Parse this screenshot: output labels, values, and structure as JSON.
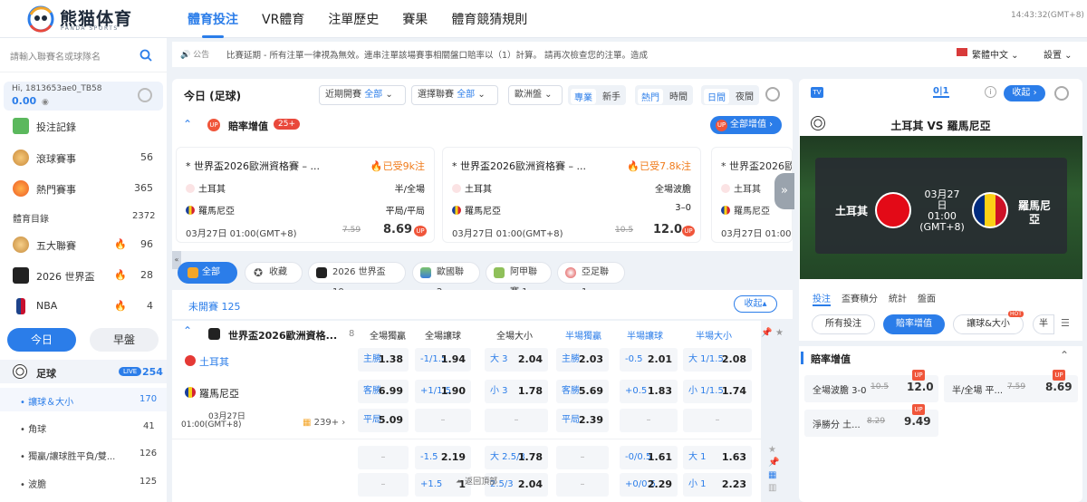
{
  "brand": {
    "name": "熊猫体育",
    "sub": "PANDA SPORTS"
  },
  "nav": [
    "體育投注",
    "VR體育",
    "注單歷史",
    "賽果",
    "體育競猜規則"
  ],
  "clock": "14:43:32(GMT+8)",
  "search": {
    "placeholder": "請輸入聯賽名或球隊名"
  },
  "notice": {
    "label": "公告",
    "text": "比賽延期 - 所有注單一律視為無效。連串注單該場賽事相關盤口賠率以（1）計算。 請再次檢查您的注單。造成",
    "lang": "繁體中文",
    "settings": "設置"
  },
  "account": {
    "id": "Hi, 1813653ae0_TB58",
    "balance": "0.00"
  },
  "sidebar": {
    "items": [
      {
        "label": "投注記錄",
        "count": ""
      },
      {
        "label": "滾球賽事",
        "count": "56"
      },
      {
        "label": "熱門賽事",
        "count": "365"
      }
    ],
    "catalog_label": "體育目錄",
    "catalog_count": "2372",
    "leagues": [
      {
        "label": "五大聯賽",
        "count": "96"
      },
      {
        "label": "2026 世界盃",
        "count": "28"
      },
      {
        "label": "NBA",
        "count": "4"
      }
    ],
    "today": "今日",
    "early": "早盤",
    "sport": {
      "label": "足球",
      "live": "LIVE",
      "count": "254"
    },
    "sub": [
      {
        "label": "讓球＆大小",
        "count": "170"
      },
      {
        "label": "角球",
        "count": "41"
      },
      {
        "label": "獨贏/讓球胜平負/雙...",
        "count": "126"
      },
      {
        "label": "波膽",
        "count": "125"
      }
    ]
  },
  "toolbar": {
    "title": "今日 (足球)",
    "f1": "近期開賽",
    "f1v": "全部",
    "f2": "選擇聯賽",
    "f2v": "全部",
    "f3": "歐洲盤",
    "t1": "專業",
    "t2": "新手",
    "t3": "熱門",
    "t4": "時間",
    "t5": "日間",
    "t6": "夜間"
  },
  "boost": {
    "title": "賠率增值",
    "count": "25+",
    "all": "全部增值"
  },
  "cards": [
    {
      "title": "* 世界盃2026歐洲資格賽 – ...",
      "hot": "已受9k注",
      "home": "土耳其",
      "away": "羅馬尼亞",
      "market": "半/全場",
      "pick": "平局/平局",
      "time": "03月27日 01:00(GMT+8)",
      "old": "7.59",
      "odd": "8.69"
    },
    {
      "title": "* 世界盃2026歐洲資格賽 – ...",
      "hot": "已受7.8k注",
      "home": "土耳其",
      "away": "羅馬尼亞",
      "market": "全場波膽",
      "pick": "3–0",
      "time": "03月27日 01:00(GMT+8)",
      "old": "10.5",
      "odd": "12.0"
    },
    {
      "title": "* 世界盃2026歐",
      "home": "土耳其",
      "away": "羅馬尼亞",
      "time": "03月27日 01:00(GMT+8)"
    }
  ],
  "chips": [
    "全部",
    "收藏",
    "2026 世界盃 10",
    "歐國聯 2",
    "阿甲聯賽 1",
    "亞足聯 1"
  ],
  "upcoming": {
    "label": "未開賽",
    "count": "125",
    "collapse": "收起"
  },
  "league": {
    "name": "世界盃2026歐洲資格...",
    "count": "8",
    "cols": [
      "全場獨贏",
      "全場讓球",
      "全場大小",
      "半場獨贏",
      "半場讓球",
      "半場大小"
    ]
  },
  "match": {
    "home": "土耳其",
    "away": "羅馬尼亞",
    "date": "03月27日",
    "time": "01:00(GMT+8)",
    "more": "239+",
    "row1": [
      [
        "主勝",
        "1.38"
      ],
      [
        "-1/1.5",
        "1.94"
      ],
      [
        "大 3",
        "2.04"
      ],
      [
        "主勝",
        "2.03"
      ],
      [
        "-0.5",
        "2.01"
      ],
      [
        "大 1/1.5",
        "2.08"
      ]
    ],
    "row2": [
      [
        "客勝",
        "6.99"
      ],
      [
        "+1/1.5",
        "1.90"
      ],
      [
        "小 3",
        "1.78"
      ],
      [
        "客勝",
        "5.69"
      ],
      [
        "+0.5",
        "1.83"
      ],
      [
        "小 1/1.5",
        "1.74"
      ]
    ],
    "row3": [
      [
        "平局",
        "5.09"
      ],
      [
        "",
        "–"
      ],
      [
        "",
        "–"
      ],
      [
        "平局",
        "2.39"
      ],
      [
        "",
        "–"
      ],
      [
        "",
        "–"
      ]
    ],
    "row4": [
      [
        "",
        "–"
      ],
      [
        "-1.5",
        "2.19"
      ],
      [
        "大 2.5/3",
        "1.78"
      ],
      [
        "",
        "–"
      ],
      [
        "-0/0.5",
        "1.61"
      ],
      [
        "大 1",
        "1.63"
      ]
    ],
    "row5": [
      [
        "",
        "–"
      ],
      [
        "+1.5",
        "1"
      ],
      [
        "2.5/3",
        "2.04"
      ],
      [
        "",
        "–"
      ],
      [
        "+0/0.5",
        "2.29"
      ],
      [
        "小 1",
        "2.23"
      ]
    ],
    "back_top": "返回頂部"
  },
  "rp": {
    "collapse": "收起",
    "match": "土耳其 VS 羅馬尼亞",
    "home": "土耳其",
    "away": "羅馬尼亞",
    "date": "03月27",
    "day": "日",
    "time": "01:00",
    "tz": "(GMT+8)",
    "tabs": [
      "投注",
      "盃賽積分",
      "統計",
      "盤面"
    ],
    "filters": [
      "所有投注",
      "賠率增值",
      "讓球&大小",
      "半"
    ],
    "hot": "HOT",
    "section": "賠率增值",
    "bets": [
      {
        "label": "全場波膽 3-0",
        "old": "10.5",
        "odd": "12.0"
      },
      {
        "label": "半/全場 平...",
        "old": "7.59",
        "odd": "8.69"
      },
      {
        "label": "淨勝分 土...",
        "old": "8.29",
        "odd": "9.49"
      }
    ]
  }
}
